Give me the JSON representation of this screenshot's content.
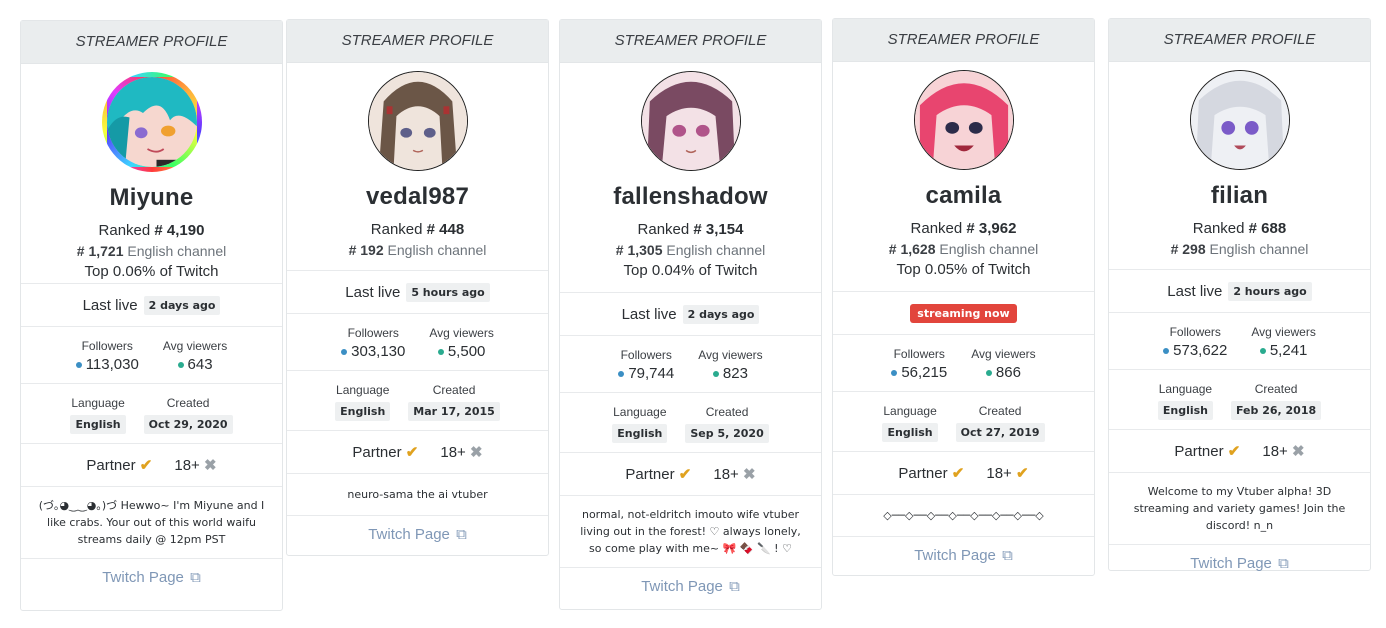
{
  "header_label": "STREAMER PROFILE",
  "labels": {
    "ranked": "Ranked",
    "last_live": "Last live",
    "followers": "Followers",
    "avg_viewers": "Avg viewers",
    "language": "Language",
    "created": "Created",
    "partner": "Partner",
    "adult": "18+",
    "twitch_page": "Twitch Page"
  },
  "colors": {
    "follower_dot": "#3b8fc4",
    "viewer_dot": "#2aab8f",
    "live_badge": "#e2453c",
    "partner_check": "#e0a21f"
  },
  "streamers": [
    {
      "name": "Miyune",
      "rank": "# 4,190",
      "lang_rank": "# 1,721",
      "lang_rank_suffix": "English channel",
      "top": "Top 0.06% of Twitch",
      "last_live": "2 days ago",
      "followers": "113,030",
      "avg_viewers": "643",
      "language": "English",
      "created": "Oct 29, 2020",
      "partner": true,
      "adult": false,
      "bio": "(づ｡◕‿‿◕｡)づ Hewwo~ I'm Miyune and I like crabs. Your out of this world waifu streams daily @ 12pm PST",
      "avatar_icon": "anime-avatar-teal-hair"
    },
    {
      "name": "vedal987",
      "rank": "# 448",
      "lang_rank": "# 192",
      "lang_rank_suffix": "English channel",
      "last_live": "5 hours ago",
      "followers": "303,130",
      "avg_viewers": "5,500",
      "language": "English",
      "created": "Mar 17, 2015",
      "partner": true,
      "adult": false,
      "bio": "neuro-sama the ai vtuber",
      "avatar_icon": "anime-avatar-brown-hair"
    },
    {
      "name": "fallenshadow",
      "rank": "# 3,154",
      "lang_rank": "# 1,305",
      "lang_rank_suffix": "English channel",
      "top": "Top 0.04% of Twitch",
      "last_live": "2 days ago",
      "followers": "79,744",
      "avg_viewers": "823",
      "language": "English",
      "created": "Sep 5, 2020",
      "partner": true,
      "adult": false,
      "bio": "normal, not-eldritch imouto wife vtuber living out in the forest! ♡ always lonely, so come play with me~ 🎀 🍫 🔪 ! ♡",
      "avatar_icon": "anime-avatar-mauve-hair"
    },
    {
      "name": "camila",
      "rank": "# 3,962",
      "lang_rank": "# 1,628",
      "lang_rank_suffix": "English channel",
      "top": "Top 0.05% of Twitch",
      "status": "streaming now",
      "followers": "56,215",
      "avg_viewers": "866",
      "language": "English",
      "created": "Oct 27, 2019",
      "partner": true,
      "adult": true,
      "bio": "◇──◇──◇──◇──◇──◇──◇──◇",
      "avatar_icon": "anime-avatar-pink-hair"
    },
    {
      "name": "filian",
      "rank": "# 688",
      "lang_rank": "# 298",
      "lang_rank_suffix": "English channel",
      "last_live": "2 hours ago",
      "followers": "573,622",
      "avg_viewers": "5,241",
      "language": "English",
      "created": "Feb 26, 2018",
      "partner": true,
      "adult": false,
      "bio": "Welcome to my Vtuber alpha! 3D streaming and variety games! Join the discord! n_n",
      "avatar_icon": "anime-avatar-silver-hair"
    }
  ]
}
